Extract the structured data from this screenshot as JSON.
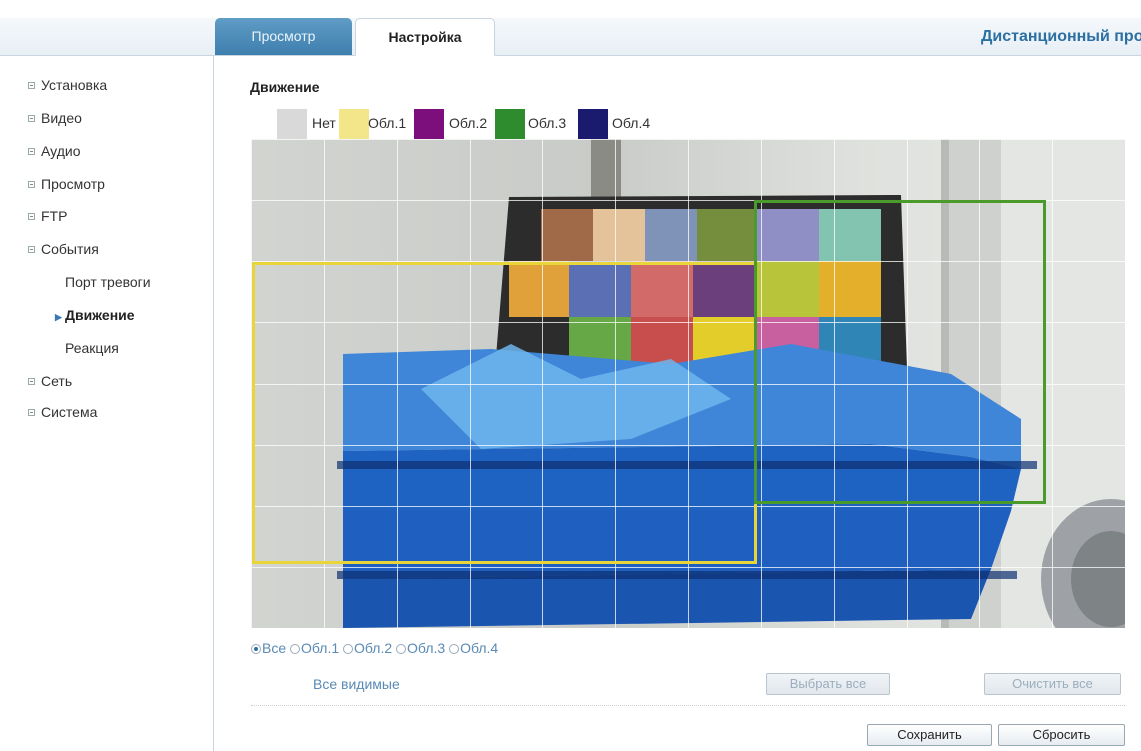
{
  "header": {
    "tabs": [
      {
        "label": "Просмотр",
        "active": false
      },
      {
        "label": "Настройка",
        "active": true
      }
    ],
    "app_title": "Дистанционный про"
  },
  "sidebar": {
    "items": [
      {
        "label": "Установка"
      },
      {
        "label": "Видео"
      },
      {
        "label": "Аудио"
      },
      {
        "label": "Просмотр"
      },
      {
        "label": "FTP"
      },
      {
        "label": "События"
      }
    ],
    "events_subitems": [
      {
        "label": "Порт тревоги"
      },
      {
        "label": "Движение",
        "active": true
      },
      {
        "label": "Реакция"
      }
    ],
    "items_after": [
      {
        "label": "Сеть"
      },
      {
        "label": "Система"
      }
    ]
  },
  "main": {
    "title": "Движение",
    "legend": [
      {
        "label": "Нет",
        "color": "#d9d9d9"
      },
      {
        "label": "Обл.1",
        "color": "#f3e68a"
      },
      {
        "label": "Обл.2",
        "color": "#7d0f7d"
      },
      {
        "label": "Обл.3",
        "color": "#2e8b2e"
      },
      {
        "label": "Обл.4",
        "color": "#1a1a6e"
      }
    ],
    "zones": [
      {
        "name": "Обл.1",
        "color": "#e8d53a"
      },
      {
        "name": "Обл.3",
        "color": "#4a9a2c"
      }
    ],
    "area_filter": {
      "options": [
        "Все",
        "Обл.1",
        "Обл.2",
        "Обл.3",
        "Обл.4"
      ],
      "selected": "Все"
    },
    "visible_all_label": "Все видимые",
    "select_all_label": "Выбрать все",
    "clear_all_label": "Очистить все",
    "save_label": "Сохранить",
    "reset_label": "Сбросить"
  }
}
